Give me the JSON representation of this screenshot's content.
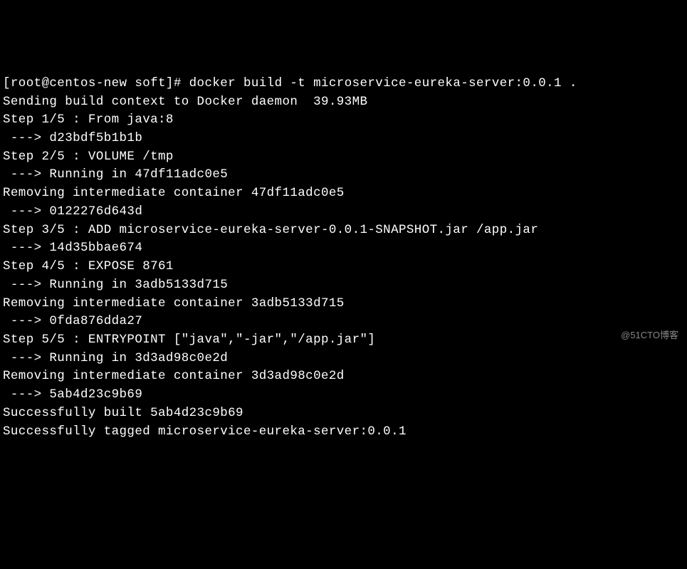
{
  "terminal": {
    "prompt": "[root@centos-new soft]# ",
    "command": "docker build -t microservice-eureka-server:0.0.1 .",
    "lines": [
      "Sending build context to Docker daemon  39.93MB",
      "Step 1/5 : From java:8",
      " ---> d23bdf5b1b1b",
      "Step 2/5 : VOLUME /tmp",
      " ---> Running in 47df11adc0e5",
      "Removing intermediate container 47df11adc0e5",
      " ---> 0122276d643d",
      "Step 3/5 : ADD microservice-eureka-server-0.0.1-SNAPSHOT.jar /app.jar",
      " ---> 14d35bbae674",
      "Step 4/5 : EXPOSE 8761",
      " ---> Running in 3adb5133d715",
      "Removing intermediate container 3adb5133d715",
      " ---> 0fda876dda27",
      "Step 5/5 : ENTRYPOINT [\"java\",\"-jar\",\"/app.jar\"]",
      " ---> Running in 3d3ad98c0e2d",
      "Removing intermediate container 3d3ad98c0e2d",
      " ---> 5ab4d23c9b69",
      "Successfully built 5ab4d23c9b69",
      "Successfully tagged microservice-eureka-server:0.0.1"
    ]
  },
  "watermark": "@51CTO博客"
}
